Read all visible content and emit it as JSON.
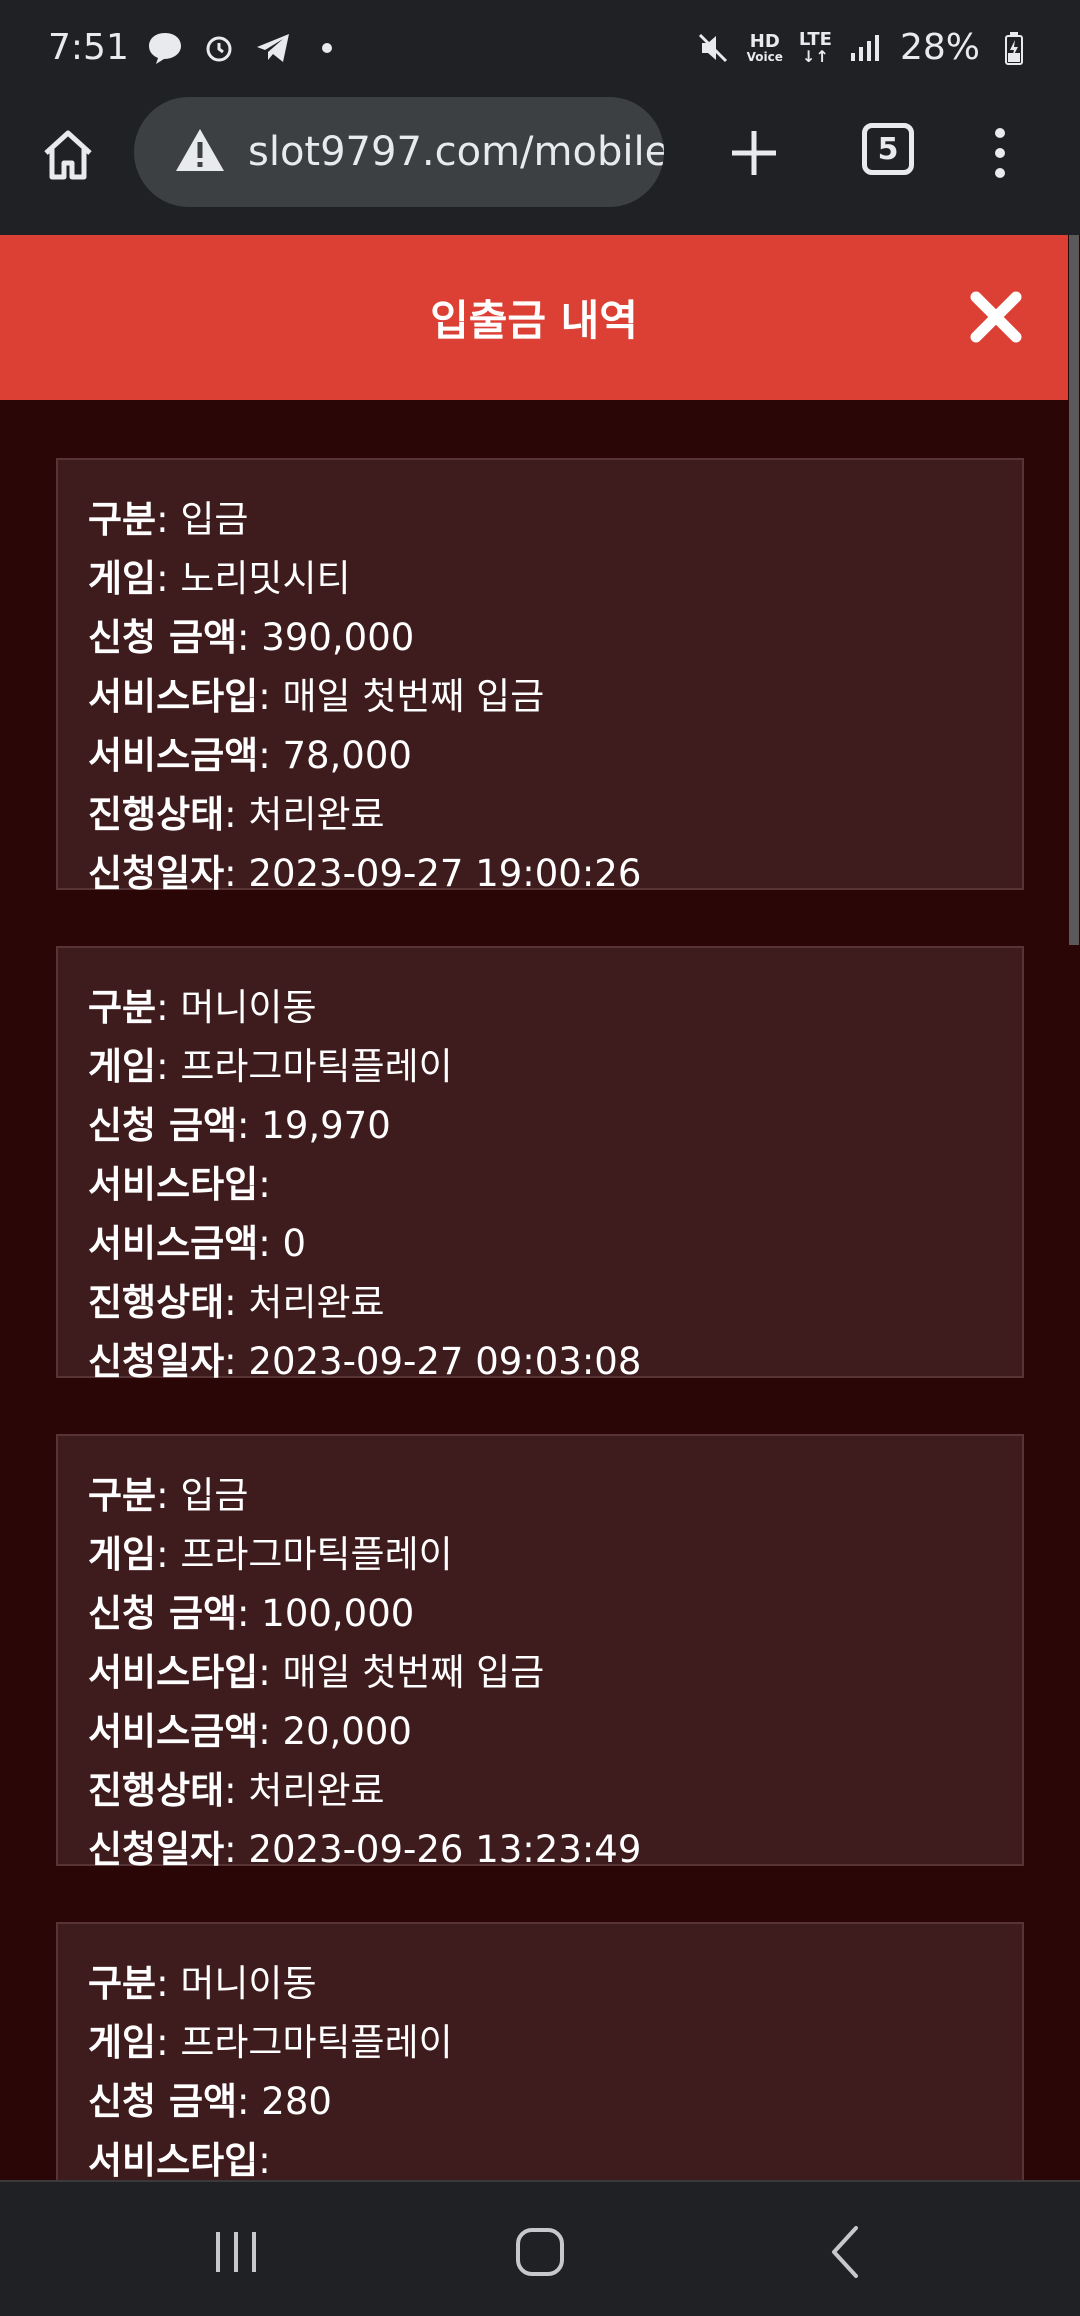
{
  "status_bar": {
    "time": "7:51",
    "battery": "28%",
    "hd_label": "HD",
    "voice_label": "Voice",
    "lte_label": "LTE"
  },
  "browser": {
    "url": "slot9797.com/mobile",
    "tab_count": "5"
  },
  "modal": {
    "title": "입출금 내역"
  },
  "labels": {
    "type": "구분",
    "game": "게임",
    "amount": "신청 금액",
    "service_type": "서비스타입",
    "service_amount": "서비스금액",
    "status": "진행상태",
    "date": "신청일자"
  },
  "records": [
    {
      "type": "입금",
      "game": "노리밋시티",
      "amount": "390,000",
      "service_type": "매일 첫번째 입금",
      "service_amount": "78,000",
      "status": "처리완료",
      "date": "2023-09-27 19:00:26"
    },
    {
      "type": "머니이동",
      "game": "프라그마틱플레이",
      "amount": "19,970",
      "service_type": "",
      "service_amount": "0",
      "status": "처리완료",
      "date": "2023-09-27 09:03:08"
    },
    {
      "type": "입금",
      "game": "프라그마틱플레이",
      "amount": "100,000",
      "service_type": "매일 첫번째 입금",
      "service_amount": "20,000",
      "status": "처리완료",
      "date": "2023-09-26 13:23:49"
    },
    {
      "type": "머니이동",
      "game": "프라그마틱플레이",
      "amount": "280",
      "service_type": "",
      "service_amount": "",
      "status": "",
      "date": ""
    }
  ]
}
